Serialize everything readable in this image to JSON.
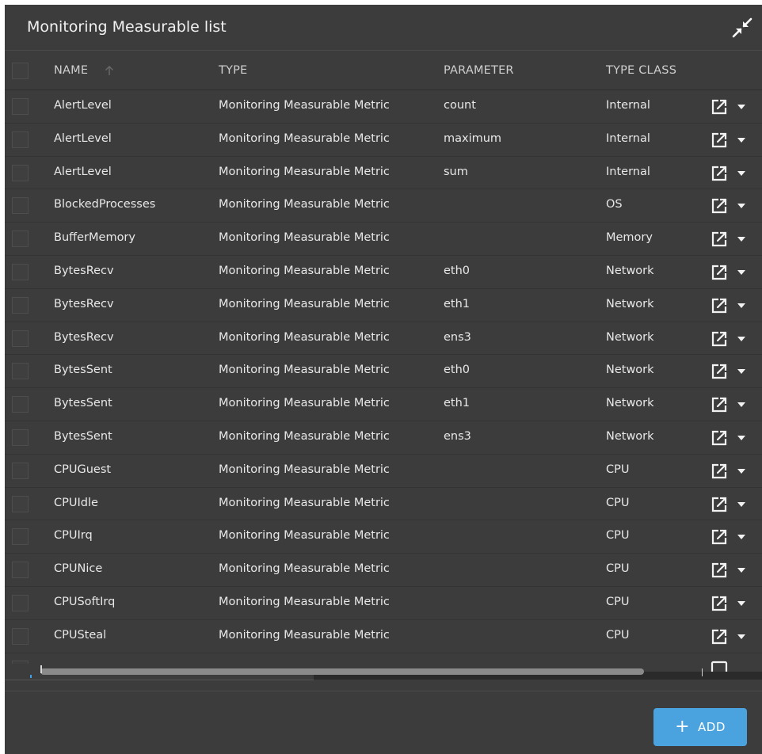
{
  "panel": {
    "title": "Monitoring Measurable list"
  },
  "columns": {
    "name": "NAME",
    "type": "TYPE",
    "parameter": "PARAMETER",
    "type_class": "TYPE CLASS"
  },
  "rows": [
    {
      "name": "AlertLevel",
      "type": "Monitoring Measurable Metric",
      "parameter": "count",
      "type_class": "Internal"
    },
    {
      "name": "AlertLevel",
      "type": "Monitoring Measurable Metric",
      "parameter": "maximum",
      "type_class": "Internal"
    },
    {
      "name": "AlertLevel",
      "type": "Monitoring Measurable Metric",
      "parameter": "sum",
      "type_class": "Internal"
    },
    {
      "name": "BlockedProcesses",
      "type": "Monitoring Measurable Metric",
      "parameter": "",
      "type_class": "OS"
    },
    {
      "name": "BufferMemory",
      "type": "Monitoring Measurable Metric",
      "parameter": "",
      "type_class": "Memory"
    },
    {
      "name": "BytesRecv",
      "type": "Monitoring Measurable Metric",
      "parameter": "eth0",
      "type_class": "Network"
    },
    {
      "name": "BytesRecv",
      "type": "Monitoring Measurable Metric",
      "parameter": "eth1",
      "type_class": "Network"
    },
    {
      "name": "BytesRecv",
      "type": "Monitoring Measurable Metric",
      "parameter": "ens3",
      "type_class": "Network"
    },
    {
      "name": "BytesSent",
      "type": "Monitoring Measurable Metric",
      "parameter": "eth0",
      "type_class": "Network"
    },
    {
      "name": "BytesSent",
      "type": "Monitoring Measurable Metric",
      "parameter": "eth1",
      "type_class": "Network"
    },
    {
      "name": "BytesSent",
      "type": "Monitoring Measurable Metric",
      "parameter": "ens3",
      "type_class": "Network"
    },
    {
      "name": "CPUGuest",
      "type": "Monitoring Measurable Metric",
      "parameter": "",
      "type_class": "CPU"
    },
    {
      "name": "CPUIdle",
      "type": "Monitoring Measurable Metric",
      "parameter": "",
      "type_class": "CPU"
    },
    {
      "name": "CPUIrq",
      "type": "Monitoring Measurable Metric",
      "parameter": "",
      "type_class": "CPU"
    },
    {
      "name": "CPUNice",
      "type": "Monitoring Measurable Metric",
      "parameter": "",
      "type_class": "CPU"
    },
    {
      "name": "CPUSoftIrq",
      "type": "Monitoring Measurable Metric",
      "parameter": "",
      "type_class": "CPU"
    },
    {
      "name": "CPUSteal",
      "type": "Monitoring Measurable Metric",
      "parameter": "",
      "type_class": "CPU"
    }
  ],
  "icons": {
    "collapse": "collapse-arrows-icon",
    "sort": "sort-ascending-arrow-icon",
    "open": "open-external-icon",
    "menu": "chevron-down-icon",
    "add": "plus-icon"
  },
  "footer": {
    "add_label": "ADD"
  },
  "colors": {
    "background": "#3c3c3c",
    "accent": "#4aa3df",
    "text": "#e8e8e8"
  }
}
